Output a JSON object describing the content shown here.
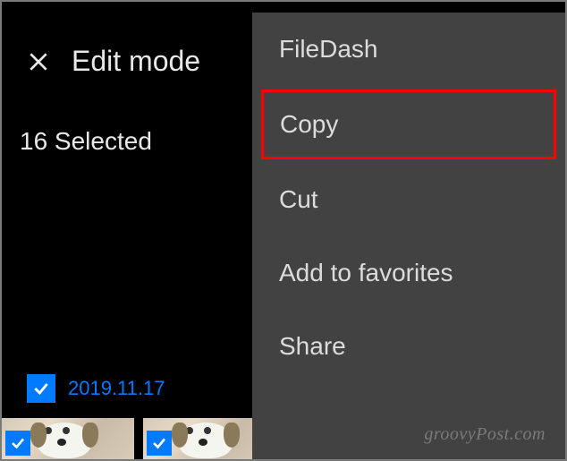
{
  "header": {
    "title": "Edit mode"
  },
  "selection": {
    "count_text": "16 Selected"
  },
  "menu": {
    "items": [
      {
        "label": "FileDash",
        "highlighted": false
      },
      {
        "label": "Copy",
        "highlighted": true
      },
      {
        "label": "Cut",
        "highlighted": false
      },
      {
        "label": "Add to favorites",
        "highlighted": false
      },
      {
        "label": "Share",
        "highlighted": false
      }
    ]
  },
  "date_group": {
    "date": "2019.11.17",
    "checked": true
  },
  "watermark": "groovyPost.com"
}
